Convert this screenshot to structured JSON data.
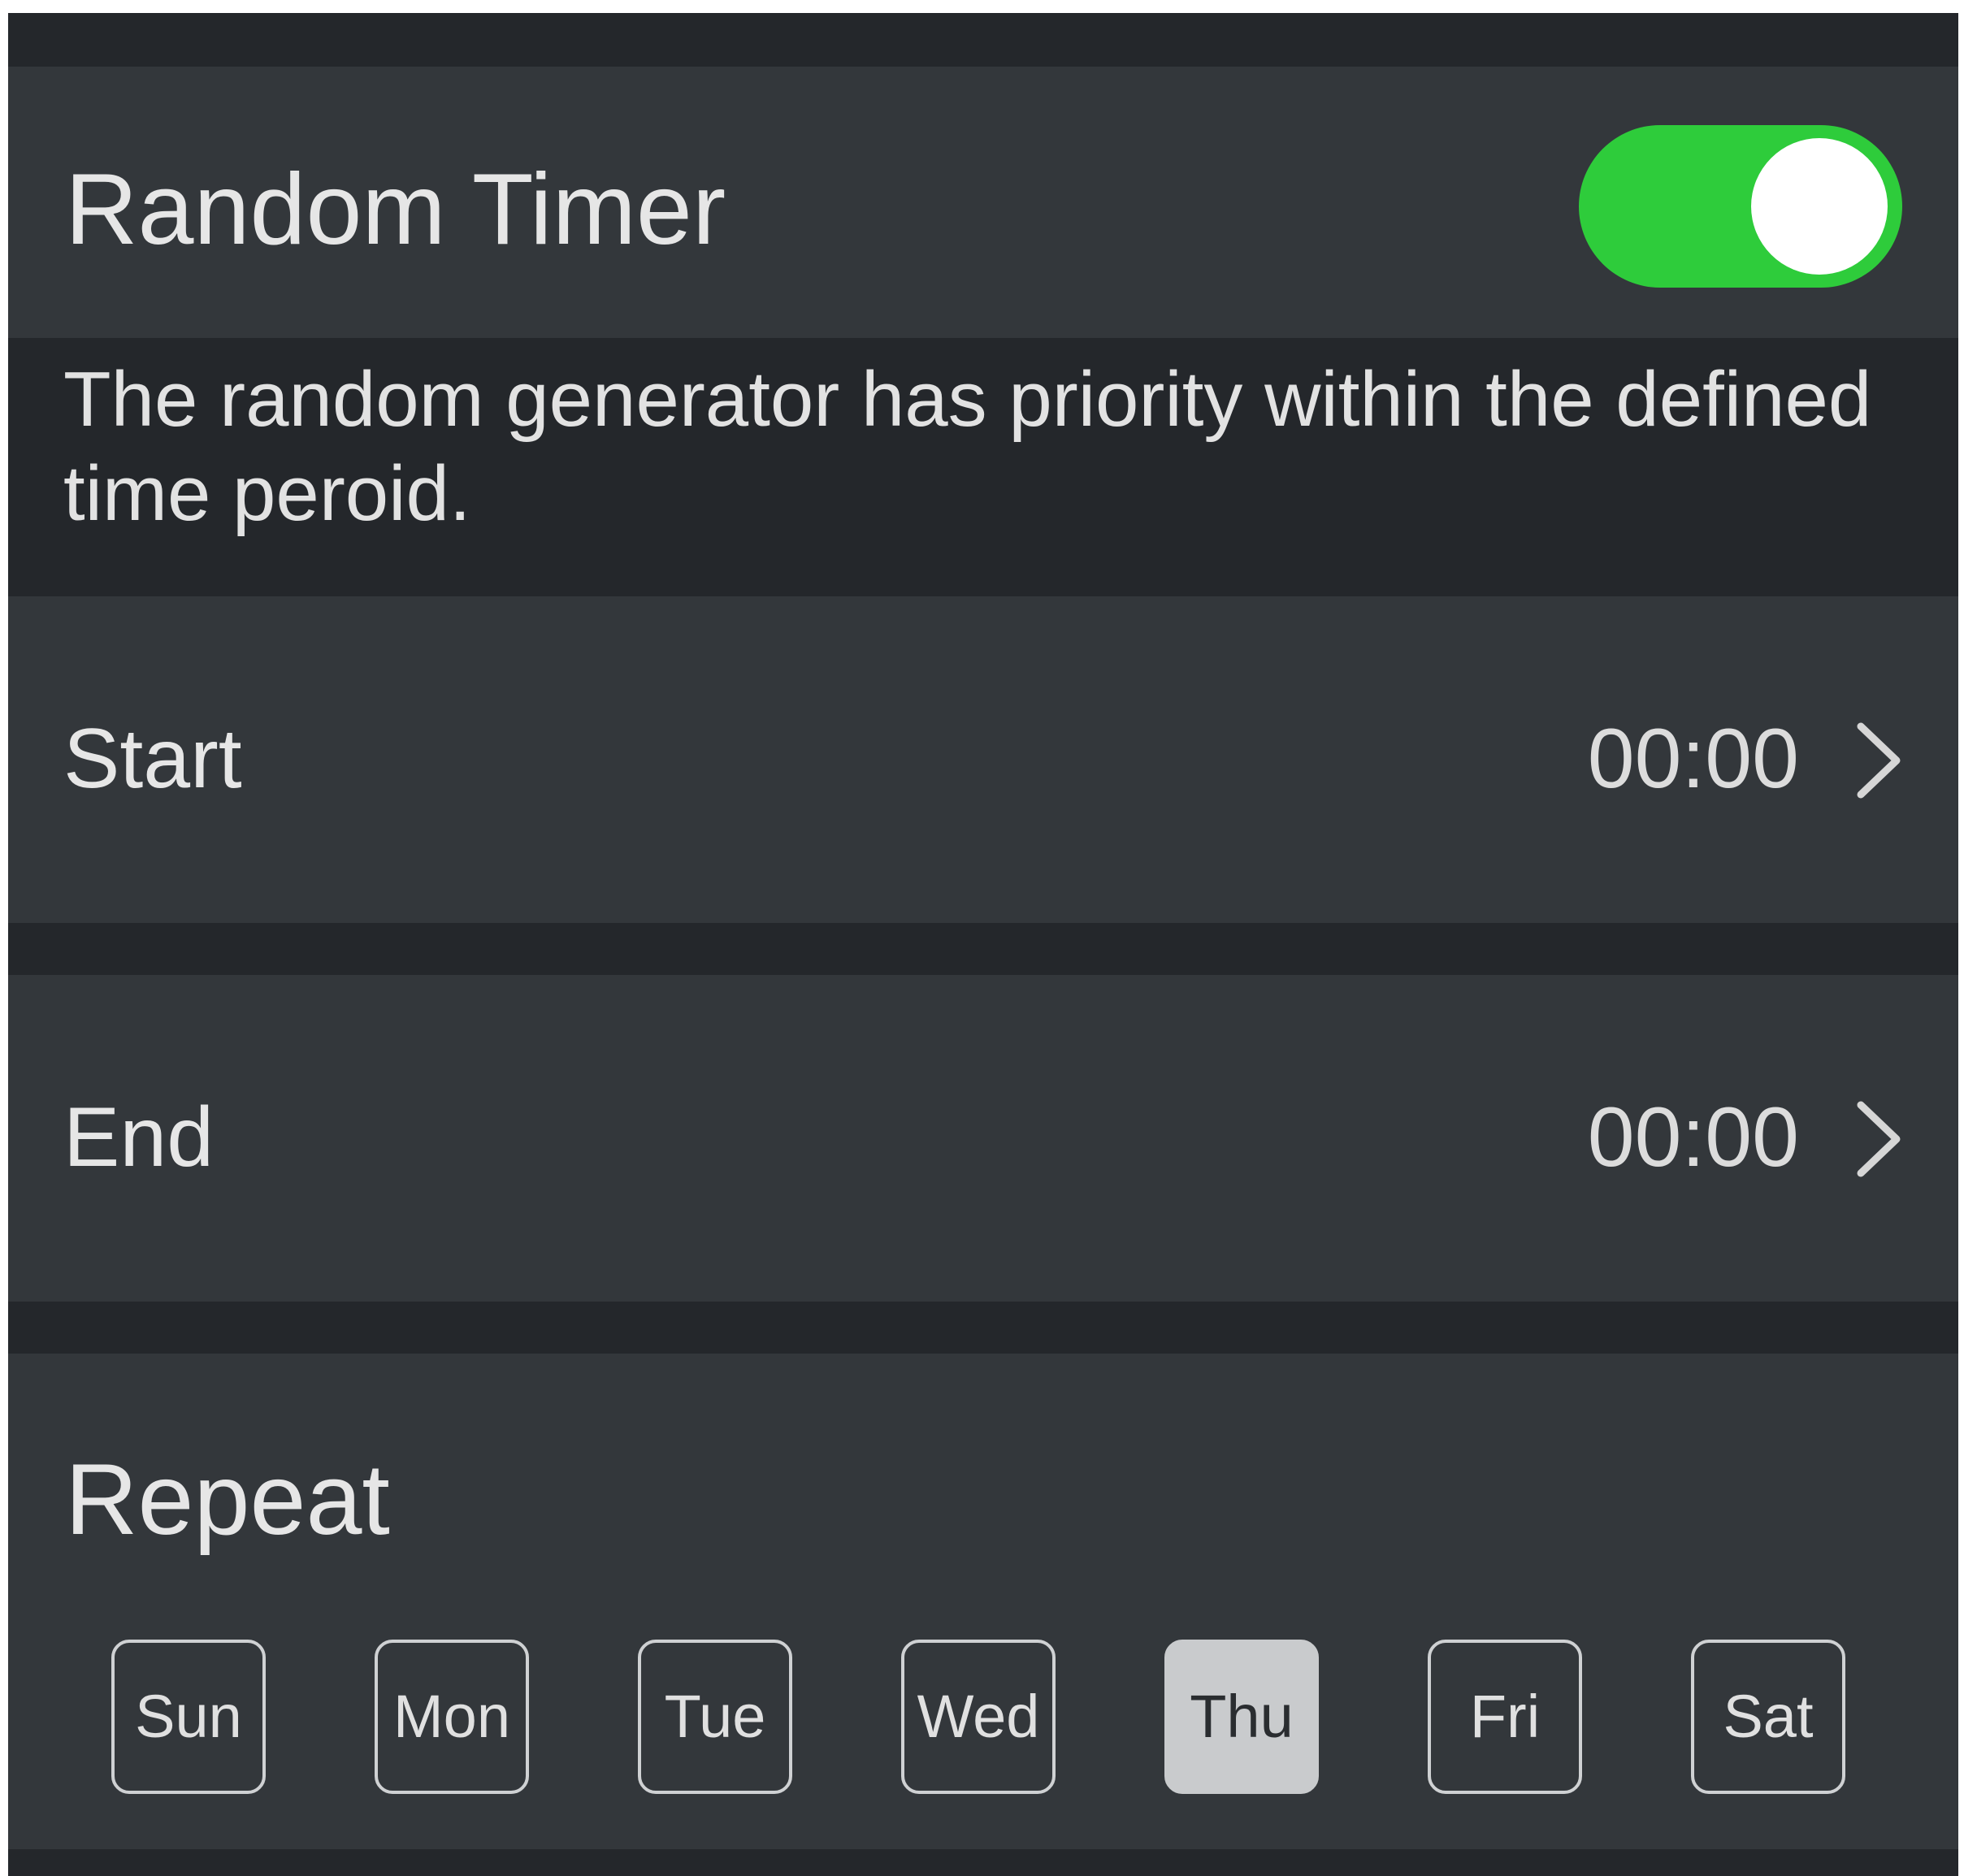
{
  "random_timer": {
    "title": "Random Timer",
    "enabled": true,
    "toggle_color": "#2ecc3b",
    "description": "The random generator has priority within the defined time peroid."
  },
  "start": {
    "label": "Start",
    "value": "00:00",
    "icon": "chevron-right-icon"
  },
  "end": {
    "label": "End",
    "value": "00:00",
    "icon": "chevron-right-icon"
  },
  "repeat": {
    "label": "Repeat",
    "days": [
      {
        "label": "Sun",
        "selected": false
      },
      {
        "label": "Mon",
        "selected": false
      },
      {
        "label": "Tue",
        "selected": false
      },
      {
        "label": "Wed",
        "selected": false
      },
      {
        "label": "Thu",
        "selected": true
      },
      {
        "label": "Fri",
        "selected": false
      },
      {
        "label": "Sat",
        "selected": false
      }
    ]
  }
}
